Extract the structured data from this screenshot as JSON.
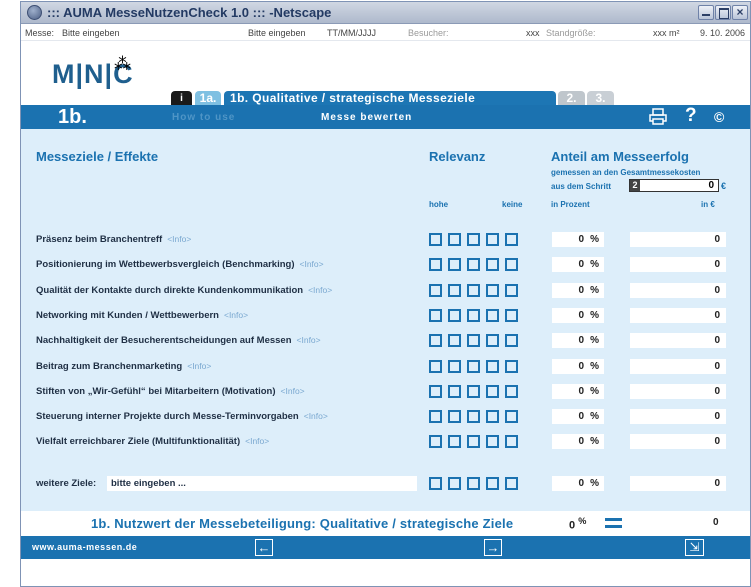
{
  "window": {
    "title": "::: AUMA MesseNutzenCheck 1.0 ::: -Netscape"
  },
  "infobar": {
    "messe_label": "Messe:",
    "messe_value": "Bitte eingeben",
    "second_value": "Bitte eingeben",
    "date_format": "TT/MM/JJJJ",
    "besucher_label": "Besucher:",
    "besucher_value": "xxx",
    "standgroesse_label": "Standgröße:",
    "standgroesse_value": "xxx m²",
    "date": "9. 10. 2006"
  },
  "logo": {
    "text": "M|N|C",
    "mark": "⁂"
  },
  "tabs": {
    "info": "i",
    "t1a": "1a.",
    "t1b": "1b. Qualitative / strategische Messeziele",
    "t2": "2.",
    "t3": "3."
  },
  "topbar": {
    "section": "1b.",
    "howto": "How to use",
    "bewerten": "Messe bewerten",
    "help": "?",
    "copyright": "©"
  },
  "headers": {
    "ziele": "Messeziele / Effekte",
    "relevanz": "Relevanz",
    "anteil": "Anteil am Messeerfolg",
    "gemessen": "gemessen an den Gesamtmessekosten",
    "schritt": "aus dem Schritt",
    "schritt_num": "2",
    "total_value": "0",
    "euro": "€",
    "hohe": "hohe",
    "keine": "keine",
    "prozent": "in Prozent",
    "in_eur": "in €"
  },
  "rows": [
    {
      "label": "Präsenz beim Branchentreff",
      "info": "<Info>",
      "pct": "0",
      "unit": "%",
      "eur": "0"
    },
    {
      "label": "Positionierung im Wettbewerbsvergleich (Benchmarking)",
      "info": "<Info>",
      "pct": "0",
      "unit": "%",
      "eur": "0"
    },
    {
      "label": "Qualität der Kontakte durch direkte Kundenkommunikation",
      "info": "<Info>",
      "pct": "0",
      "unit": "%",
      "eur": "0"
    },
    {
      "label": "Networking mit Kunden / Wettbewerbern",
      "info": "<Info>",
      "pct": "0",
      "unit": "%",
      "eur": "0"
    },
    {
      "label": "Nachhaltigkeit der Besucherentscheidungen auf Messen",
      "info": "<Info>",
      "pct": "0",
      "unit": "%",
      "eur": "0"
    },
    {
      "label": "Beitrag zum Branchenmarketing",
      "info": "<Info>",
      "pct": "0",
      "unit": "%",
      "eur": "0"
    },
    {
      "label": "Stiften von „Wir-Gefühl“ bei Mitarbeitern (Motivation)",
      "info": "<Info>",
      "pct": "0",
      "unit": "%",
      "eur": "0"
    },
    {
      "label": "Steuerung interner Projekte durch Messe-Terminvorgaben",
      "info": "<Info>",
      "pct": "0",
      "unit": "%",
      "eur": "0"
    },
    {
      "label": "Vielfalt erreichbarer Ziele (Multifunktionalität)",
      "info": "<Info>",
      "pct": "0",
      "unit": "%",
      "eur": "0"
    }
  ],
  "more_goals": {
    "label": "weitere Ziele:",
    "value": "bitte eingeben ...",
    "pct": "0",
    "unit": "%",
    "eur": "0"
  },
  "summary": {
    "label": "1b. Nutzwert der Messebeteiligung: Qualitative / strategische Ziele",
    "pct": "0",
    "unit": "%",
    "eur": "0"
  },
  "footer": {
    "url": "www.auma-messen.de",
    "back": "←",
    "next": "→",
    "exit": "⇲"
  },
  "colors": {
    "brand_blue": "#1b72b0",
    "panel": "#ddeefa"
  }
}
